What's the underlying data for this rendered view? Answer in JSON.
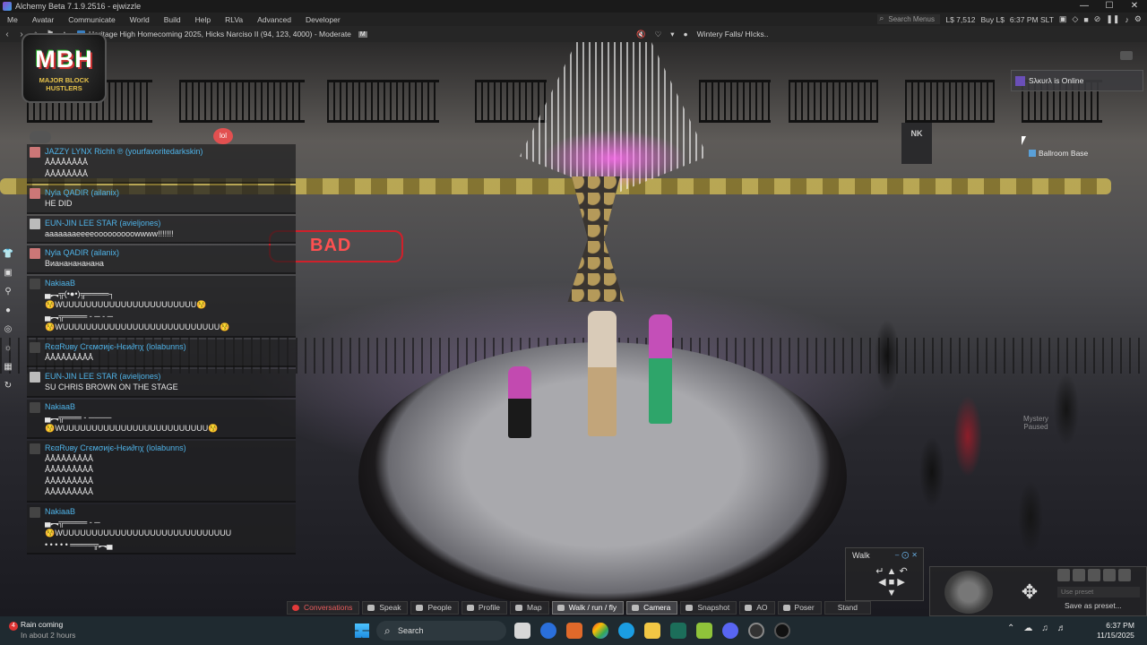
{
  "window": {
    "title": "Alchemy Beta 7.1.9.2516 - ejwizzle",
    "controls": [
      "—",
      "☐",
      "✕"
    ]
  },
  "menubar": {
    "items": [
      "Me",
      "Avatar",
      "Communicate",
      "World",
      "Build",
      "Help",
      "RLVa",
      "Advanced",
      "Developer"
    ],
    "search_placeholder": "Search Menus",
    "balance": "L$ 7,512",
    "buy": "Buy L$",
    "time": "6:37 PM SLT"
  },
  "navbar": {
    "location": "Heritage High Homecoming 2025, Hicks Narciso II (94, 123, 4000) - Moderate",
    "maturity": "M",
    "parcel_media": "Wintery Falls/ HIcks.."
  },
  "logo": {
    "text": "MBH",
    "subtitle_1": "MAJOR BLOCK",
    "subtitle_2": "HUSTLERS"
  },
  "scene_text": {
    "sign": "BAD",
    "nk_sign": "NK",
    "mystery": [
      "Mystery",
      "Paused"
    ]
  },
  "notifications": {
    "online": "Sλκυrλ is Online",
    "parcel": "Ballroom Base"
  },
  "chat": {
    "badge": "lol",
    "entries": [
      {
        "name": "JAZZY LYNX  Richh ℗ (yourfavoritedarkskin)",
        "thumb": "r",
        "lines": [
          "ÅÅÅÅÅÅÅÅ",
          "ÅÅÅÅÅÅÅÅ"
        ]
      },
      {
        "name": "Nyla QADIR (ailanix)",
        "thumb": "r",
        "lines": [
          "HE DID"
        ]
      },
      {
        "name": "EUN-JIN LEE STAR  (avieljones)",
        "thumb": "w",
        "lines": [
          "aaaaaaaeeeeooooooooowwww!!!!!!!"
        ]
      },
      {
        "name": "Nyla QADIR (ailanix)",
        "thumb": "r",
        "lines": [
          "Виананананана"
        ]
      },
      {
        "name": "NakiaaB",
        "thumb": "d",
        "lines": [
          "▄︻╦(•●•)╦════┐",
          "😚WUUUUUUUUUUUUUUUUUUUUUUU😚",
          "▄︻╦════ - ─ - ─",
          "😚WUUUUUUUUUUUUUUUUUUUUUUUUUUU😚"
        ]
      },
      {
        "name": "RєαRυву Cгємσиjє-Hєи∂гιχ (lolabunns)",
        "thumb": "d",
        "lines": [
          "ÅÅÅÅÅÅÅÅÅ"
        ]
      },
      {
        "name": "EUN-JIN LEE STAR  (avieljones)",
        "thumb": "w",
        "lines": [
          "SU CHRIS BROWN ON THE STAGE"
        ]
      },
      {
        "name": "NakiaaB",
        "thumb": "d",
        "lines": [
          "▄︻╦═══ - ────",
          "😚WUUUUUUUUUUUUUUUUUUUUUUUUU😚"
        ]
      },
      {
        "name": "RєαRυву Cгємσиjє-Hєи∂гιχ (lolabunns)",
        "thumb": "d",
        "lines": [
          "ÅÅÅÅÅÅÅÅÅ",
          "ÅÅÅÅÅÅÅÅÅ",
          "ÅÅÅÅÅÅÅÅÅ",
          "ÅÅÅÅÅÅÅÅÅ"
        ]
      },
      {
        "name": "NakiaaB",
        "thumb": "d",
        "lines": [
          "▄︻╦════ - ─",
          "😚WUUUUUUUUUUUUUUUUUUUUUUUUUUUUU",
          "• • • • • ════╦︻▄"
        ]
      }
    ]
  },
  "walk_panel": {
    "title": "Walk"
  },
  "camera": {
    "use_preset": "Use preset",
    "save_preset": "Save as preset..."
  },
  "bottom_toolbar": [
    "Conversations",
    "Speak",
    "People",
    "Profile",
    "Map",
    "Walk / run / fly",
    "Camera",
    "Snapshot",
    "AO",
    "Poser",
    "Stand"
  ],
  "taskbar": {
    "weather_title": "Rain coming",
    "weather_sub": "In about 2 hours",
    "weather_badge": "4",
    "search": "Search",
    "time": "6:37 PM",
    "date": "11/15/2025"
  }
}
